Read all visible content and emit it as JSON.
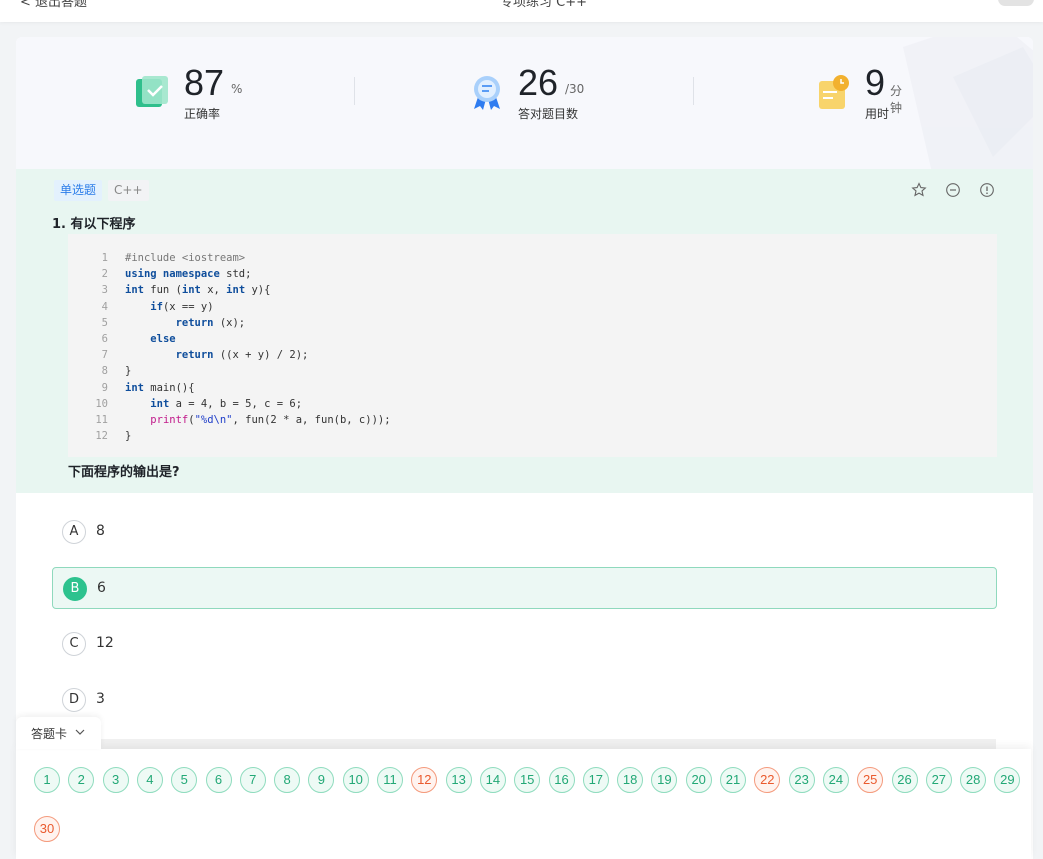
{
  "topbar": {
    "back_label": "< 退出答题",
    "center_label": "专项练习 C++"
  },
  "stats": {
    "accuracy": {
      "value": "87",
      "unit": "%",
      "label": "正确率"
    },
    "correct": {
      "value": "26",
      "unit": "/30",
      "label": "答对题目数"
    },
    "time": {
      "value": "9",
      "unit": "分钟",
      "label": "用时"
    }
  },
  "question": {
    "type_tag": "单选题",
    "lang_tag": "C++",
    "title": "1. 有以下程序",
    "code_lines": [
      "#include <iostream>",
      "using namespace std;",
      "int fun (int x, int y){",
      "    if(x == y)",
      "        return (x);",
      "    else",
      "        return ((x + y) / 2);",
      "}",
      "int main(){",
      "    int a = 4, b = 5, c = 6;",
      "    printf(\"%d\\n\", fun(2 * a, fun(b, c)));",
      "}"
    ],
    "prompt": "下面程序的输出是?",
    "options": [
      {
        "letter": "A",
        "text": "8",
        "selected": false
      },
      {
        "letter": "B",
        "text": "6",
        "selected": true
      },
      {
        "letter": "C",
        "text": "12",
        "selected": false
      },
      {
        "letter": "D",
        "text": "3",
        "selected": false
      }
    ]
  },
  "answer_sheet": {
    "label": "答题卡",
    "items": [
      {
        "n": "1",
        "s": "ok"
      },
      {
        "n": "2",
        "s": "ok"
      },
      {
        "n": "3",
        "s": "ok"
      },
      {
        "n": "4",
        "s": "ok"
      },
      {
        "n": "5",
        "s": "ok"
      },
      {
        "n": "6",
        "s": "ok"
      },
      {
        "n": "7",
        "s": "ok"
      },
      {
        "n": "8",
        "s": "ok"
      },
      {
        "n": "9",
        "s": "ok"
      },
      {
        "n": "10",
        "s": "ok"
      },
      {
        "n": "11",
        "s": "ok"
      },
      {
        "n": "12",
        "s": "bad"
      },
      {
        "n": "13",
        "s": "ok"
      },
      {
        "n": "14",
        "s": "ok"
      },
      {
        "n": "15",
        "s": "ok"
      },
      {
        "n": "16",
        "s": "ok"
      },
      {
        "n": "17",
        "s": "ok"
      },
      {
        "n": "18",
        "s": "ok"
      },
      {
        "n": "19",
        "s": "ok"
      },
      {
        "n": "20",
        "s": "ok"
      },
      {
        "n": "21",
        "s": "ok"
      },
      {
        "n": "22",
        "s": "bad"
      },
      {
        "n": "23",
        "s": "ok"
      },
      {
        "n": "24",
        "s": "ok"
      },
      {
        "n": "25",
        "s": "bad"
      },
      {
        "n": "26",
        "s": "ok"
      },
      {
        "n": "27",
        "s": "ok"
      },
      {
        "n": "28",
        "s": "ok"
      },
      {
        "n": "29",
        "s": "ok"
      },
      {
        "n": "30",
        "s": "bad"
      }
    ]
  },
  "colors": {
    "correct": "#22a876",
    "wrong": "#ea5a2e",
    "accent": "#2dc28e"
  },
  "icons": [
    "checklist-icon",
    "award-ribbon-icon",
    "clipboard-clock-icon",
    "star-icon",
    "minus-circle-icon",
    "info-circle-icon",
    "chevron-down-icon"
  ]
}
